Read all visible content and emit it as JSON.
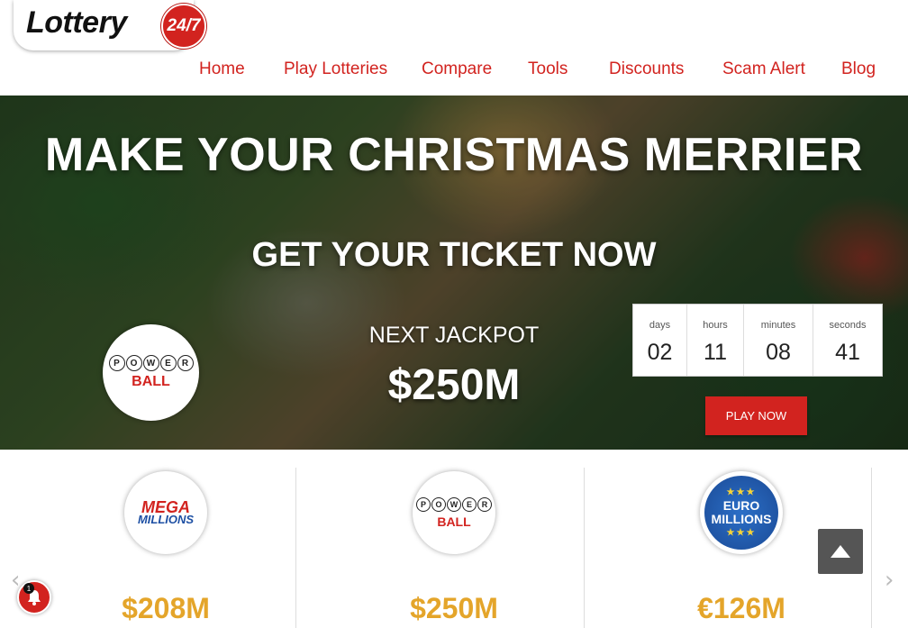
{
  "logo": {
    "text": "Lottery",
    "badge": "24/7"
  },
  "nav": {
    "items": [
      {
        "label": "Home"
      },
      {
        "label": "Play Lotteries"
      },
      {
        "label": "Compare"
      },
      {
        "label": "Tools"
      },
      {
        "label": "Discounts"
      },
      {
        "label": "Scam Alert"
      },
      {
        "label": "Blog"
      }
    ]
  },
  "hero": {
    "title": "MAKE YOUR CHRISTMAS MERRIER",
    "subtitle": "GET YOUR TICKET NOW",
    "next_jackpot_label": "NEXT JACKPOT",
    "jackpot_amount": "$250M",
    "lottery_logo": {
      "letters": [
        "P",
        "O",
        "W",
        "E",
        "R"
      ],
      "ball": "BALL"
    },
    "countdown": {
      "days_label": "days",
      "days": "02",
      "hours_label": "hours",
      "hours": "11",
      "minutes_label": "minutes",
      "minutes": "08",
      "seconds_label": "seconds",
      "seconds": "41"
    },
    "play_button": "PLAY NOW"
  },
  "cards": [
    {
      "logo_title": "MEGA",
      "logo_sub": "MILLIONS",
      "amount": "$208M"
    },
    {
      "logo_letters": [
        "P",
        "O",
        "W",
        "E",
        "R"
      ],
      "logo_ball": "BALL",
      "amount": "$250M"
    },
    {
      "logo_title": "EURO",
      "logo_sub": "MILLIONS",
      "amount": "€126M"
    }
  ],
  "notification": {
    "count": "1"
  },
  "colors": {
    "accent": "#d2231f",
    "gold": "#e4a52a"
  }
}
